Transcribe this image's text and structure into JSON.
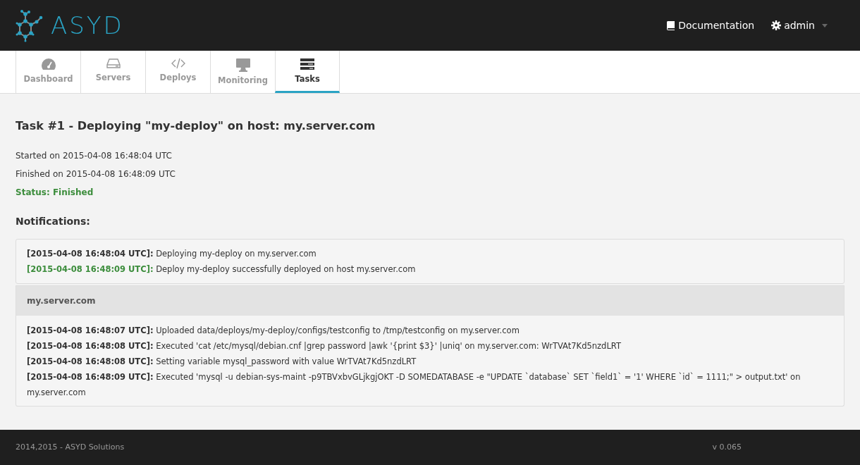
{
  "header": {
    "logo_text": "ASYD",
    "links": [
      {
        "label": "Documentation",
        "dropdown": false
      },
      {
        "label": "admin",
        "dropdown": true
      }
    ]
  },
  "tabs": [
    {
      "label": "Dashboard",
      "selected": false
    },
    {
      "label": "Servers",
      "selected": false
    },
    {
      "label": "Deploys",
      "selected": false
    },
    {
      "label": "Monitoring",
      "selected": false
    },
    {
      "label": "Tasks",
      "selected": true
    }
  ],
  "task": {
    "title": "Task #1 - Deploying \"my-deploy\" on host: my.server.com",
    "started": "Started on 2015-04-08 16:48:04 UTC",
    "finished": "Finished on 2015-04-08 16:48:09 UTC",
    "status": "Status: Finished"
  },
  "notifications_heading": "Notifications:",
  "notifications": [
    {
      "timestamp": "[2015-04-08 16:48:04 UTC]:",
      "message": "Deploying my-deploy on my.server.com",
      "kind": "info"
    },
    {
      "timestamp": "[2015-04-08 16:48:09 UTC]:",
      "message": "Deploy my-deploy successfully deployed on host my.server.com",
      "kind": "success"
    }
  ],
  "hosts": [
    {
      "name": "my.server.com",
      "entries": [
        {
          "timestamp": "[2015-04-08 16:48:07 UTC]:",
          "message": "Uploaded data/deploys/my-deploy/configs/testconfig to /tmp/testconfig on my.server.com",
          "kind": "info"
        },
        {
          "timestamp": "[2015-04-08 16:48:08 UTC]:",
          "message": "Executed 'cat /etc/mysql/debian.cnf |grep password |awk '{print $3}' |uniq' on my.server.com: WrTVAt7Kd5nzdLRT",
          "kind": "info"
        },
        {
          "timestamp": "[2015-04-08 16:48:08 UTC]:",
          "message": "Setting variable mysql_password with value WrTVAt7Kd5nzdLRT",
          "kind": "info"
        },
        {
          "timestamp": "[2015-04-08 16:48:09 UTC]:",
          "message": "Executed 'mysql -u debian-sys-maint -p9TBVxbvGLjkgjOKT -D SOMEDATABASE -e \"UPDATE `database` SET `field1` = '1' WHERE `id` = 1111;\" > output.txt' on my.server.com",
          "kind": "info"
        }
      ]
    }
  ],
  "footer": {
    "copyright": "2014,2015 - ASYD Solutions",
    "version": "v 0.065"
  }
}
